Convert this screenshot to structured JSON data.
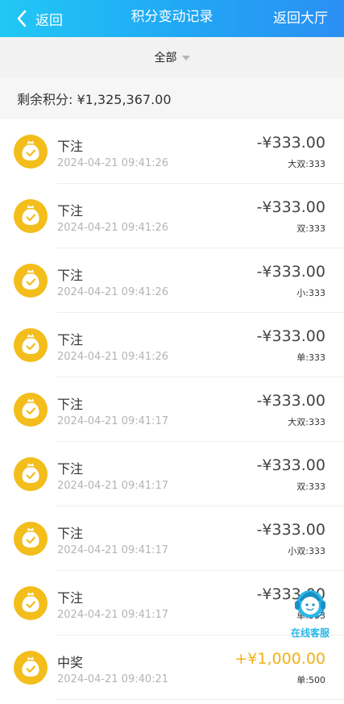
{
  "header": {
    "back_label": "返回",
    "title": "积分变动记录",
    "hall_label": "返回大厅"
  },
  "filter": {
    "selected": "全部"
  },
  "balance": {
    "text": "剩余积分: ¥1,325,367.00"
  },
  "records": [
    {
      "type": "下注",
      "time": "2024-04-21 09:41:26",
      "amount": "-¥333.00",
      "detail": "大双:333",
      "kind": "bet"
    },
    {
      "type": "下注",
      "time": "2024-04-21 09:41:26",
      "amount": "-¥333.00",
      "detail": "双:333",
      "kind": "bet"
    },
    {
      "type": "下注",
      "time": "2024-04-21 09:41:26",
      "amount": "-¥333.00",
      "detail": "小:333",
      "kind": "bet"
    },
    {
      "type": "下注",
      "time": "2024-04-21 09:41:26",
      "amount": "-¥333.00",
      "detail": "单:333",
      "kind": "bet"
    },
    {
      "type": "下注",
      "time": "2024-04-21 09:41:17",
      "amount": "-¥333.00",
      "detail": "大双:333",
      "kind": "bet"
    },
    {
      "type": "下注",
      "time": "2024-04-21 09:41:17",
      "amount": "-¥333.00",
      "detail": "双:333",
      "kind": "bet"
    },
    {
      "type": "下注",
      "time": "2024-04-21 09:41:17",
      "amount": "-¥333.00",
      "detail": "小双:333",
      "kind": "bet"
    },
    {
      "type": "下注",
      "time": "2024-04-21 09:41:17",
      "amount": "-¥333.00",
      "detail": "单:333",
      "kind": "bet"
    },
    {
      "type": "中奖",
      "time": "2024-04-21 09:40:21",
      "amount": "+¥1,000.00",
      "detail": "单:500",
      "kind": "win"
    }
  ],
  "service": {
    "label": "在线客服"
  },
  "colors": {
    "header_start": "#21c8f5",
    "header_end": "#2b8ff2",
    "coin": "#f3bd1b",
    "win_amount": "#f2b114",
    "service": "#2bb8e8"
  },
  "icons": {
    "back": "chevron-left-icon",
    "filter_caret": "caret-down-icon",
    "record": "money-bag-icon",
    "service": "customer-service-icon"
  }
}
